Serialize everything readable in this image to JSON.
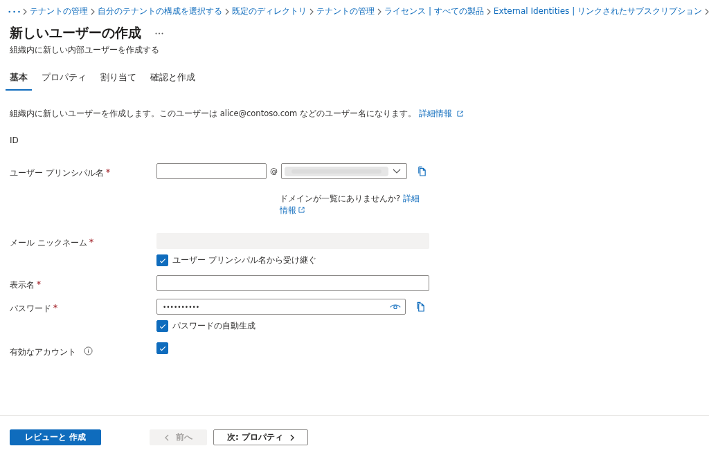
{
  "breadcrumb": [
    "テナントの管理",
    "自分のテナントの構成を選択する",
    "既定のディレクトリ",
    "テナントの管理",
    "ライセンス | すべての製品",
    "External Identities | リンクされたサブスクリプション"
  ],
  "title": "新しいユーザーの作成",
  "subtitle": "組織内に新しい内部ユーザーを作成する",
  "tabs": [
    {
      "label": "基本",
      "selected": true
    },
    {
      "label": "プロパティ",
      "selected": false
    },
    {
      "label": "割り当て",
      "selected": false
    },
    {
      "label": "確認と作成",
      "selected": false
    }
  ],
  "description": {
    "text": "組織内に新しいユーザーを作成します。このユーザーは alice@contoso.com などのユーザー名になります。",
    "link": "詳細情報"
  },
  "section": "ID",
  "fields": [
    {
      "kind": "upn",
      "label": "ユーザー プリンシパル名",
      "required": true,
      "at": "@",
      "hint": "ドメインが一覧にありませんか?",
      "hint_link_1": "詳細",
      "hint_link_2": "情報"
    },
    {
      "kind": "disabled",
      "label": "メール ニックネーム",
      "required": true,
      "checkbox": {
        "label": "ユーザー プリンシパル名から受け継ぐ",
        "checked": true
      }
    },
    {
      "kind": "text",
      "label": "表示名",
      "required": true
    },
    {
      "kind": "password",
      "label": "パスワード",
      "required": true,
      "value": "••••••••••",
      "checkbox": {
        "label": "パスワードの自動生成",
        "checked": true
      }
    },
    {
      "kind": "check",
      "label": "有効なアカウント",
      "required": false,
      "info": true,
      "checked": true
    }
  ],
  "footer": {
    "review": "レビューと 作成",
    "prev": {
      "label": "前へ",
      "disabled": true
    },
    "next": {
      "label": "次: プロパティ",
      "disabled": false
    }
  }
}
